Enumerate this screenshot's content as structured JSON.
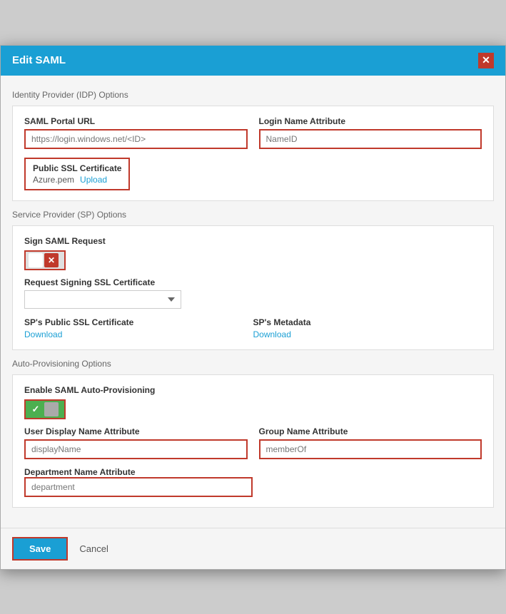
{
  "modal": {
    "title": "Edit SAML",
    "close_label": "✕"
  },
  "idp_section": {
    "title": "Identity Provider (IDP) Options",
    "saml_portal_url": {
      "label": "SAML Portal URL",
      "placeholder": "https://login.windows.net/<ID>",
      "value": ""
    },
    "login_name_attribute": {
      "label": "Login Name Attribute",
      "placeholder": "NameID",
      "value": ""
    },
    "ssl_cert": {
      "label": "Public SSL Certificate",
      "filename": "Azure.pem",
      "upload_label": "Upload"
    }
  },
  "sp_section": {
    "title": "Service Provider (SP) Options",
    "sign_saml_request": {
      "label": "Sign SAML Request",
      "enabled": false
    },
    "request_signing_ssl": {
      "label": "Request Signing SSL Certificate",
      "options": [
        ""
      ],
      "selected": ""
    },
    "sp_public_ssl": {
      "label": "SP's Public SSL Certificate",
      "download_label": "Download"
    },
    "sp_metadata": {
      "label": "SP's Metadata",
      "download_label": "Download"
    }
  },
  "auto_provisioning_section": {
    "title": "Auto-Provisioning Options",
    "enable_label": "Enable SAML Auto-Provisioning",
    "enabled": true,
    "user_display_name": {
      "label": "User Display Name Attribute",
      "placeholder": "displayName",
      "value": ""
    },
    "group_name": {
      "label": "Group Name Attribute",
      "placeholder": "memberOf",
      "value": ""
    },
    "department_name": {
      "label": "Department Name Attribute",
      "placeholder": "department",
      "value": ""
    }
  },
  "footer": {
    "save_label": "Save",
    "cancel_label": "Cancel"
  }
}
